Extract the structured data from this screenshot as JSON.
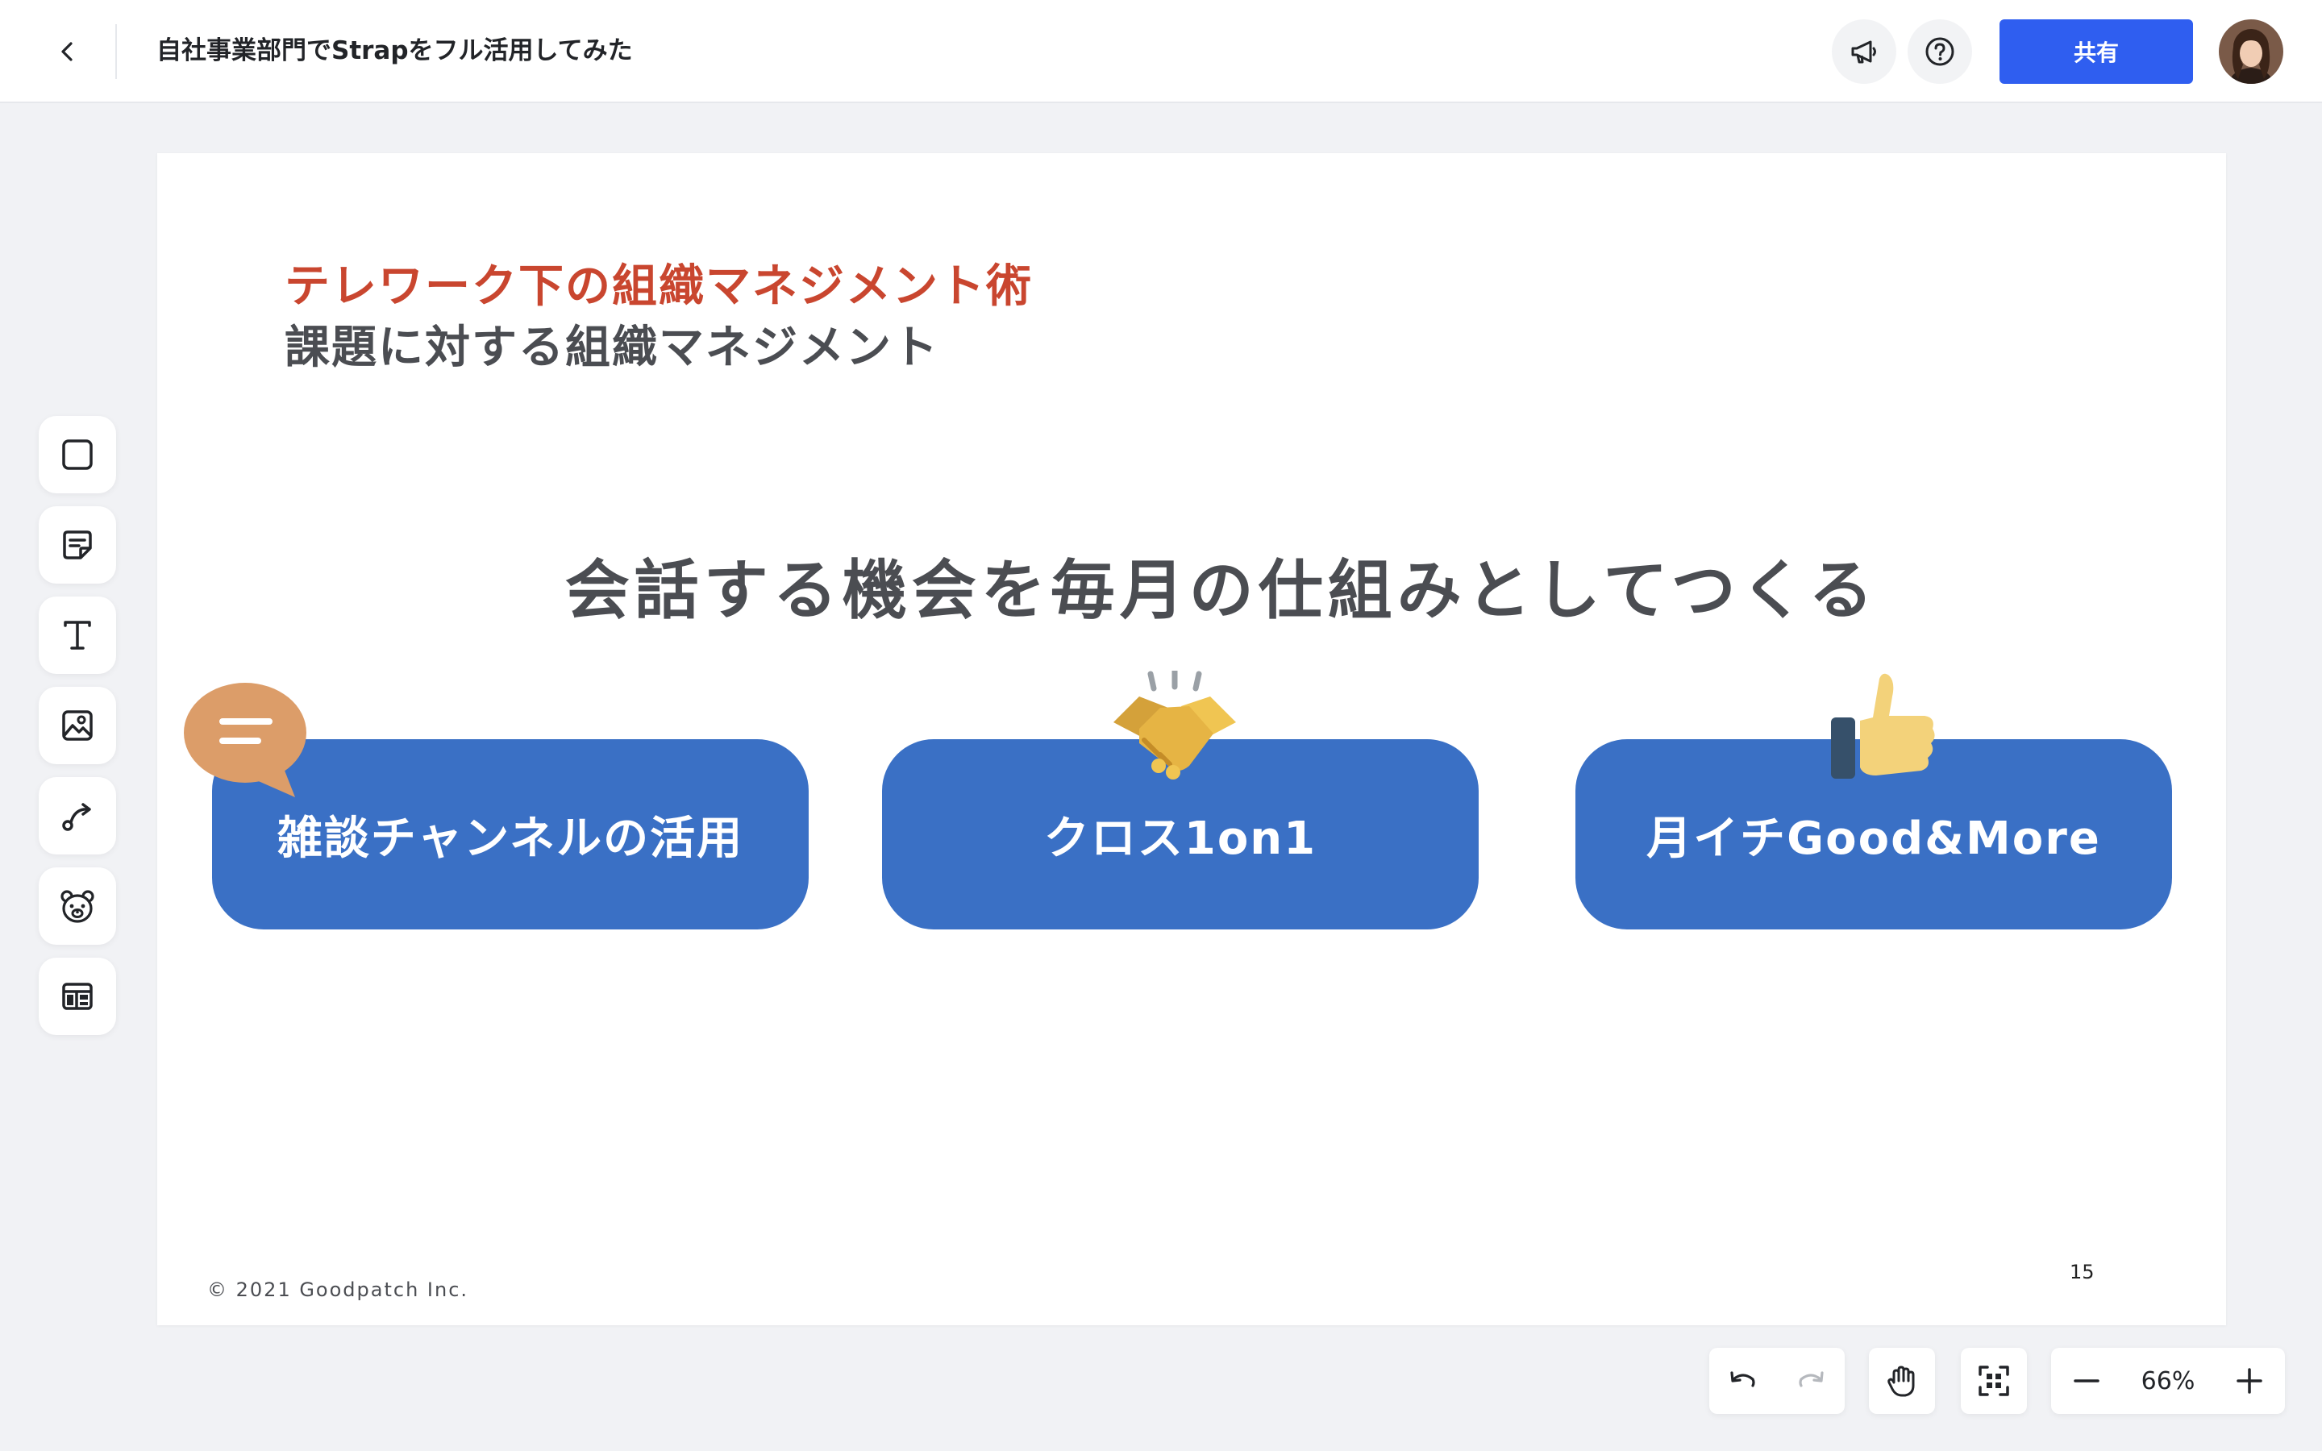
{
  "header": {
    "back_icon": "chevron-left-icon",
    "title": "自社事業部門でStrapをフル活用してみた",
    "announcement_icon": "megaphone-icon",
    "help_icon": "question-circle-icon",
    "share_label": "共有",
    "avatar_icon": "user-avatar"
  },
  "tools": [
    {
      "name": "shape-tool",
      "icon": "square-icon"
    },
    {
      "name": "sticky-note-tool",
      "icon": "sticky-note-icon"
    },
    {
      "name": "text-tool",
      "icon": "text-t-icon"
    },
    {
      "name": "image-tool",
      "icon": "image-icon"
    },
    {
      "name": "connector-tool",
      "icon": "connector-arrow-icon"
    },
    {
      "name": "stamp-tool",
      "icon": "bear-face-icon"
    },
    {
      "name": "template-tool",
      "icon": "template-layout-icon"
    }
  ],
  "slide": {
    "title_line1": "テレワーク下の組織マネジメント術",
    "title_line2": "課題に対する組織マネジメント",
    "headline": "会話する機会を毎月の仕組みとしてつくる",
    "cards": [
      {
        "label": "雑談チャンネルの活用",
        "icon": "chat-bubble-icon"
      },
      {
        "label": "クロス1on1",
        "icon": "handshake-icon"
      },
      {
        "label": "月イチGood&More",
        "icon": "thumbs-up-icon"
      }
    ],
    "copyright": "© 2021 Goodpatch Inc.",
    "page_number": "15"
  },
  "colors": {
    "accent_red": "#c9462f",
    "card_blue": "#3a70c5",
    "share_blue": "#2f5ef0",
    "text_gray": "#4b4d52"
  },
  "bottom_bar": {
    "undo_icon": "undo-icon",
    "redo_icon": "redo-icon",
    "hand_icon": "hand-pan-icon",
    "fit_icon": "fit-to-screen-icon",
    "zoom_out_icon": "minus-icon",
    "zoom_level": "66%",
    "zoom_in_icon": "plus-icon"
  }
}
